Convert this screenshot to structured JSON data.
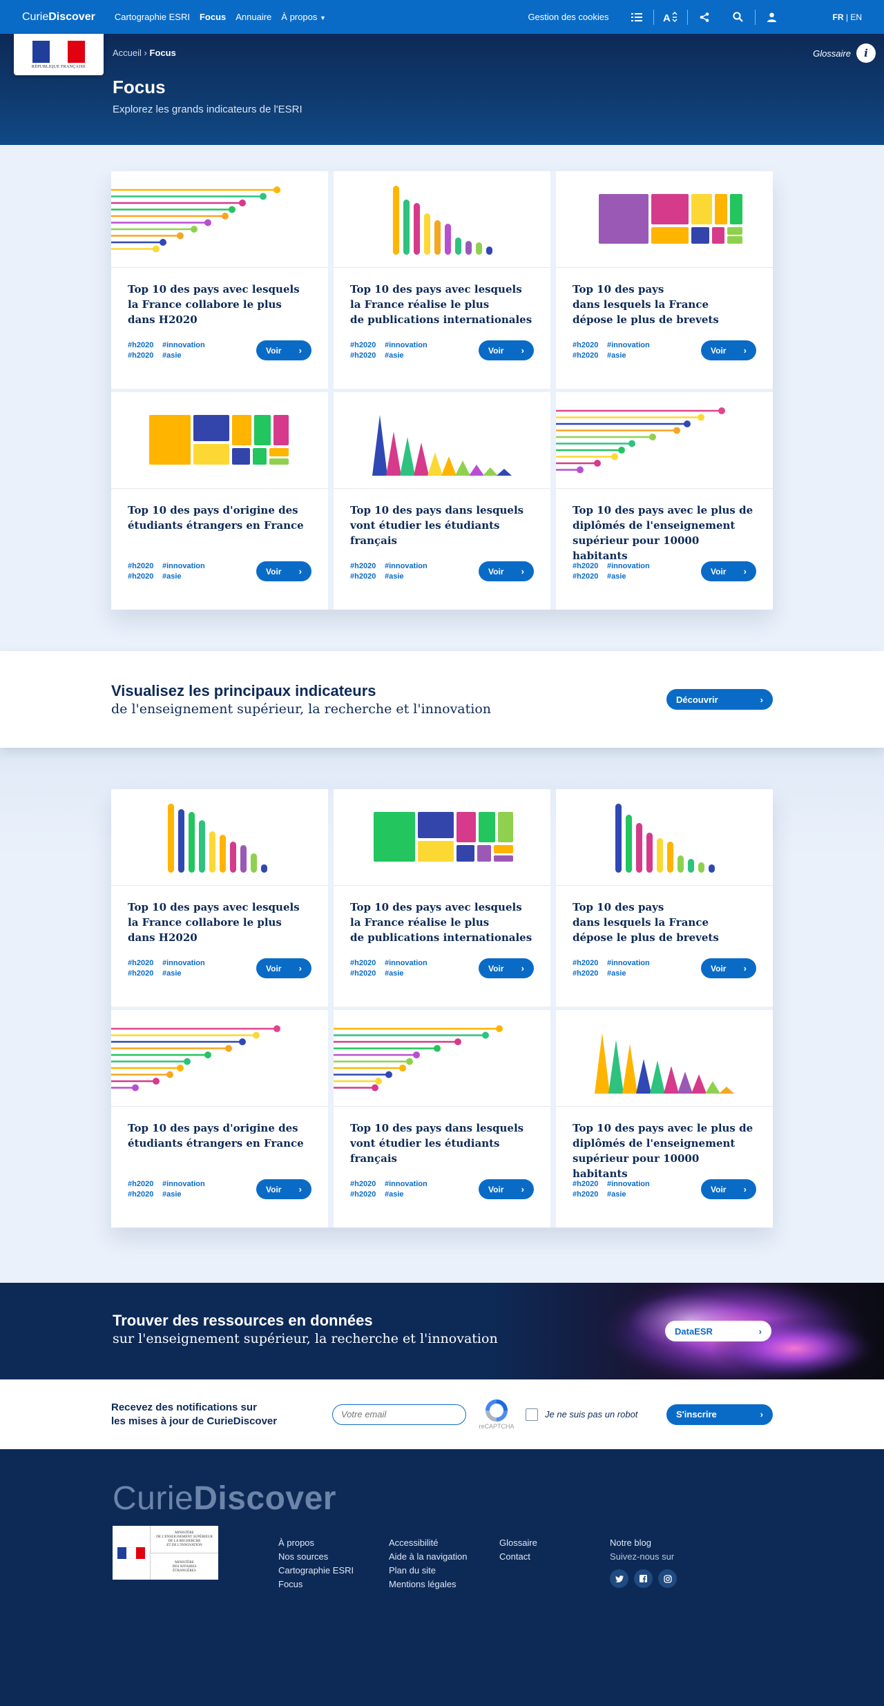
{
  "nav": {
    "brand_light": "Curie",
    "brand_bold": "Discover",
    "links": [
      "Cartographie ESRI",
      "Focus",
      "Annuaire",
      "À propos"
    ],
    "cookies": "Gestion des cookies",
    "lang_fr": "FR",
    "lang_sep": "|",
    "lang_en": "EN"
  },
  "header": {
    "logo_text": "RÉPUBLIQUE FRANÇAISE",
    "breadcrumb_home": "Accueil",
    "breadcrumb_sep": "›",
    "breadcrumb_current": "Focus",
    "glossaire": "Glossaire",
    "title": "Focus",
    "subtitle": "Explorez les grands indicateurs de l'ESRI"
  },
  "cards": [
    {
      "title": "Top 10 des pays avec lesquels\nla France collabore le plus\ndans H2020",
      "visual": "lollipop-a"
    },
    {
      "title": "Top 10 des pays avec lesquels\nla France réalise le plus\nde publications internationales",
      "visual": "bars-a"
    },
    {
      "title": "Top 10 des pays\ndans lesquels la France\ndépose le plus de brevets",
      "visual": "treemap-a"
    },
    {
      "title": "Top 10 des pays d'origine des\nétudiants étrangers en France",
      "visual": "treemap-b"
    },
    {
      "title": "Top 10 des pays dans lesquels\nvont étudier les étudiants\nfrançais",
      "visual": "triangles-a"
    },
    {
      "title": "Top 10 des pays avec le plus de\ndiplômés de l'enseignement\nsupérieur pour 10000 habitants",
      "visual": "lollipop-b"
    }
  ],
  "cards2": [
    {
      "title": "Top 10 des pays avec lesquels\nla France collabore le plus\ndans H2020",
      "visual": "bars-b"
    },
    {
      "title": "Top 10 des pays avec lesquels\nla France réalise le plus\nde publications internationales",
      "visual": "treemap-c"
    },
    {
      "title": "Top 10 des pays\ndans lesquels la France\ndépose le plus de brevets",
      "visual": "bars-c"
    },
    {
      "title": "Top 10 des pays d'origine des\nétudiants étrangers en France",
      "visual": "lollipop-c"
    },
    {
      "title": "Top 10 des pays dans lesquels\nvont étudier les étudiants\nfrançais",
      "visual": "lollipop-d"
    },
    {
      "title": "Top 10 des pays avec le plus de\ndiplômés de l'enseignement\nsupérieur pour 10000 habitants",
      "visual": "triangles-b"
    }
  ],
  "card_tags": [
    "#h2020",
    "#innovation",
    "#h2020",
    "#asie"
  ],
  "card_button": "Voir",
  "promo": {
    "title": "Visualisez les principaux indicateurs",
    "subtitle": "de l'enseignement supérieur, la recherche et l'innovation",
    "button": "Découvrir"
  },
  "resources": {
    "title": "Trouver des ressources en données",
    "subtitle": "sur l'enseignement supérieur, la recherche et l'innovation",
    "button": "DataESR"
  },
  "newsletter": {
    "text": "Recevez des notifications sur\nles mises à jour de CurieDiscover",
    "email_placeholder": "Votre email",
    "captcha_label": "reCAPTCHA",
    "robot_label": "Je ne suis pas un robot",
    "button": "S'inscrire"
  },
  "footer": {
    "brand_light": "Curie",
    "brand_bold": "Discover",
    "ministry1": "MINISTÈRE\nDE L'ENSEIGNEMENT SUPÉRIEUR\nDE LA RECHERCHE\nET DE L'INNOVATION",
    "ministry2": "MINISTÈRE\nDES AFFAIRES\nÉTRANGÈRES",
    "col1": [
      "À propos",
      "Nos sources",
      "Cartographie ESRI",
      "Focus"
    ],
    "col2": [
      "Accessibilité",
      "Aide à la navigation",
      "Plan du site",
      "Mentions légales"
    ],
    "col3": [
      "Glossaire",
      "Contact"
    ],
    "blog": "Notre blog",
    "follow": "Suivez-nous sur"
  },
  "palette": [
    "#ffb400",
    "#22c55e",
    "#4caf50",
    "#d63a8b",
    "#9b59b6",
    "#8fd14f",
    "#3344aa",
    "#fcd835",
    "#e8507a",
    "#0a6bc7"
  ]
}
